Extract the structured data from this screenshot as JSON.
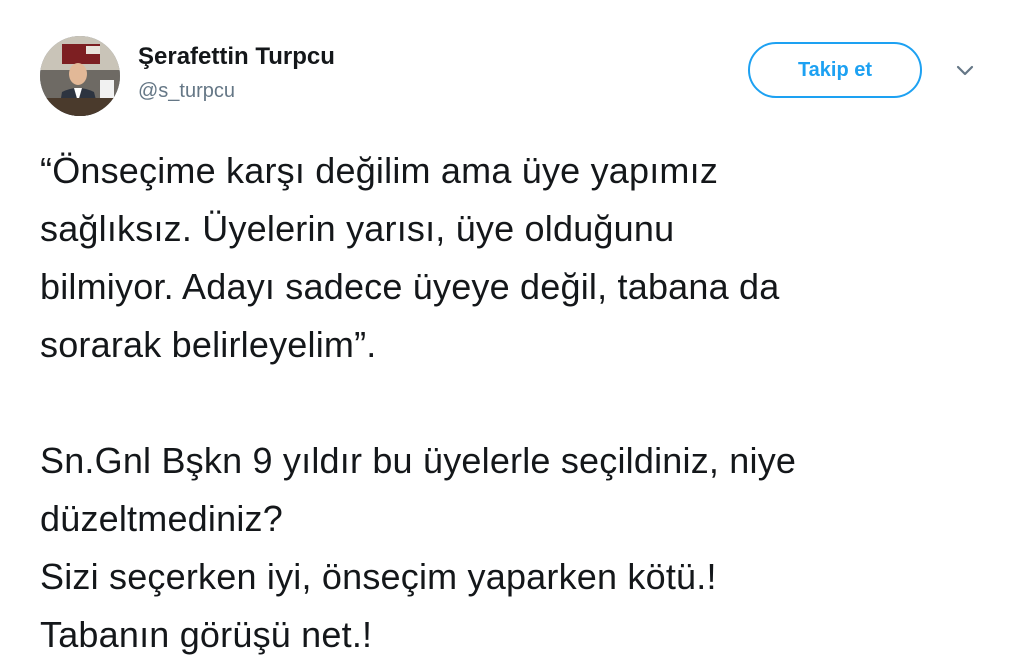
{
  "author": {
    "display_name": "Şerafettin Turpcu",
    "handle": "@s_turpcu",
    "avatar_icon": "profile-photo"
  },
  "actions": {
    "follow_label": "Takip et",
    "more_icon": "chevron-down-icon"
  },
  "colors": {
    "accent": "#1da1f2",
    "text": "#14171a",
    "secondary_text": "#657786"
  },
  "tweet": {
    "paragraph_1": [
      "“Önseçime karşı değilim ama üye yapımız",
      "sağlıksız. Üyelerin yarısı, üye olduğunu",
      "bilmiyor. Adayı sadece üyeye değil, tabana da",
      "sorarak belirleyelim”."
    ],
    "paragraph_2": [
      "Sn.Gnl Bşkn 9 yıldır bu üyelerle seçildiniz, niye",
      "düzeltmediniz?",
      "Sizi seçerken iyi, önseçim yaparken kötü.!",
      "Tabanın görüşü net.!"
    ]
  }
}
